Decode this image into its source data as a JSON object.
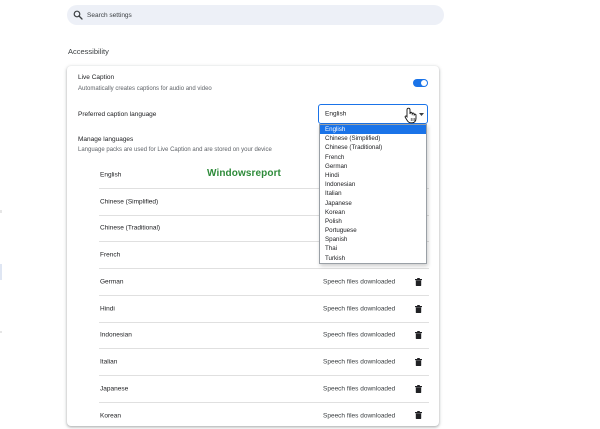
{
  "search": {
    "placeholder": "Search settings"
  },
  "section": {
    "title": "Accessibility"
  },
  "live_caption": {
    "title": "Live Caption",
    "subtitle": "Automatically creates captions for audio and video",
    "enabled": true
  },
  "preferred_language": {
    "label": "Preferred caption language",
    "selected": "English",
    "options": [
      "English",
      "Chinese (Simplified)",
      "Chinese (Traditional)",
      "French",
      "German",
      "Hindi",
      "Indonesian",
      "Italian",
      "Japanese",
      "Korean",
      "Polish",
      "Portuguese",
      "Spanish",
      "Thai",
      "Turkish"
    ]
  },
  "manage_languages": {
    "title": "Manage languages",
    "subtitle": "Language packs are used for Live Caption and are stored on your device",
    "rows": [
      {
        "name": "English",
        "status": ""
      },
      {
        "name": "Chinese (Simplified)",
        "status": ""
      },
      {
        "name": "Chinese (Traditional)",
        "status": ""
      },
      {
        "name": "French",
        "status": ""
      },
      {
        "name": "German",
        "status": "Speech files downloaded"
      },
      {
        "name": "Hindi",
        "status": "Speech files downloaded"
      },
      {
        "name": "Indonesian",
        "status": "Speech files downloaded"
      },
      {
        "name": "Italian",
        "status": "Speech files downloaded"
      },
      {
        "name": "Japanese",
        "status": "Speech files downloaded"
      },
      {
        "name": "Korean",
        "status": "Speech files downloaded"
      }
    ]
  },
  "watermark": "Windowsreport",
  "colors": {
    "accent": "#1a73e8",
    "watermark": "#2e8b3a"
  }
}
